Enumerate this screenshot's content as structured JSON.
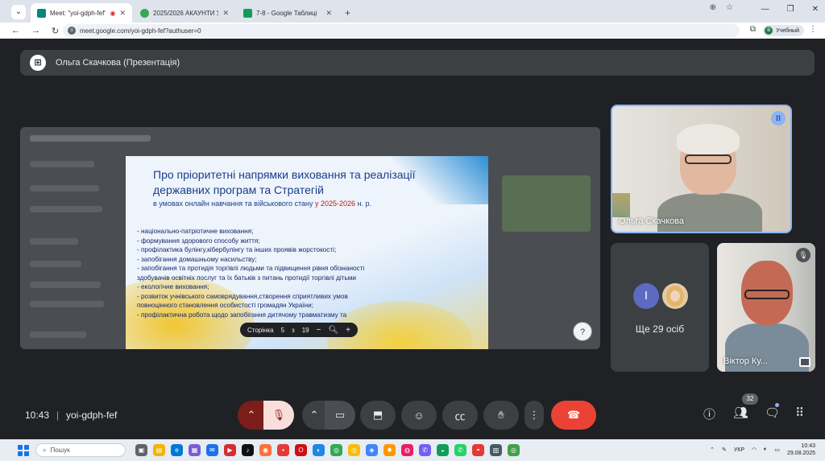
{
  "browser": {
    "tabs": [
      {
        "title": "Meet: \"yoi-gdph-fef\"",
        "active": true,
        "favicon_color": "#00897b"
      },
      {
        "title": "2025/2026 АКАУНТИ УЧНІВ - ",
        "active": false,
        "favicon_color": "#34a853"
      },
      {
        "title": "7-8 - Google Таблиці",
        "active": false,
        "favicon_color": "#0f9d58"
      }
    ],
    "url": "meet.google.com/yoi-gdph-fef?authuser=0",
    "profile_label": "Учебный",
    "profile_initial": "В"
  },
  "meet": {
    "presenter_title": "Ольга Скачкова (Презентація)",
    "slide": {
      "title_line1": "Про пріоритетні напрямки виховання та реалізації",
      "title_line2": "державних програм та Стратегій",
      "subtitle_prefix": "в умовах онлайн навчання та військового стану",
      "subtitle_year": "у  2025-2026",
      "subtitle_suffix": "н. р.",
      "items": [
        "- національно-патріотичне виховання;",
        " - формування здорового     способу життя;",
        "  -   профілактика булінгу,кібербулінгу  та     інших проявів жорстокості;",
        "  -    запобігання домашньому насильству;",
        "- запобігання та протидія торгівлі людьми  та  підвищення рівня обізнаності",
        "здобувачів освітніх послуг та їх батьків з питань протидії торгівлі дітьми",
        "  - екологічне виховання;",
        "  -  розвиток учнівського самоврядування,створення сприятливих умов",
        "повноцінного становлення             особистості громадян України;",
        "  - профілактична робота щодо запобігання дитячому травматизму та"
      ]
    },
    "pager": {
      "label": "Сторінка",
      "current": "5",
      "of_label": "з",
      "total": "19"
    },
    "tiles": {
      "main_name": "Ольга Скачкова",
      "more_initial": "І",
      "more_label": "Ще 29 осіб",
      "guy_name": "Віктор Ку..."
    },
    "controls": {
      "time": "10:43",
      "separator": "|",
      "meeting_code": "yoi-gdph-fef",
      "participants_count": "32"
    }
  },
  "taskbar": {
    "search_placeholder": "Пошук",
    "lang": "УКР",
    "time": "10:43",
    "date": "29.08.2025"
  },
  "colors": {
    "meet_bg": "#202124",
    "end_call": "#ea4335",
    "mic_off": "#f9dedc",
    "accent": "#8ab4f8"
  }
}
